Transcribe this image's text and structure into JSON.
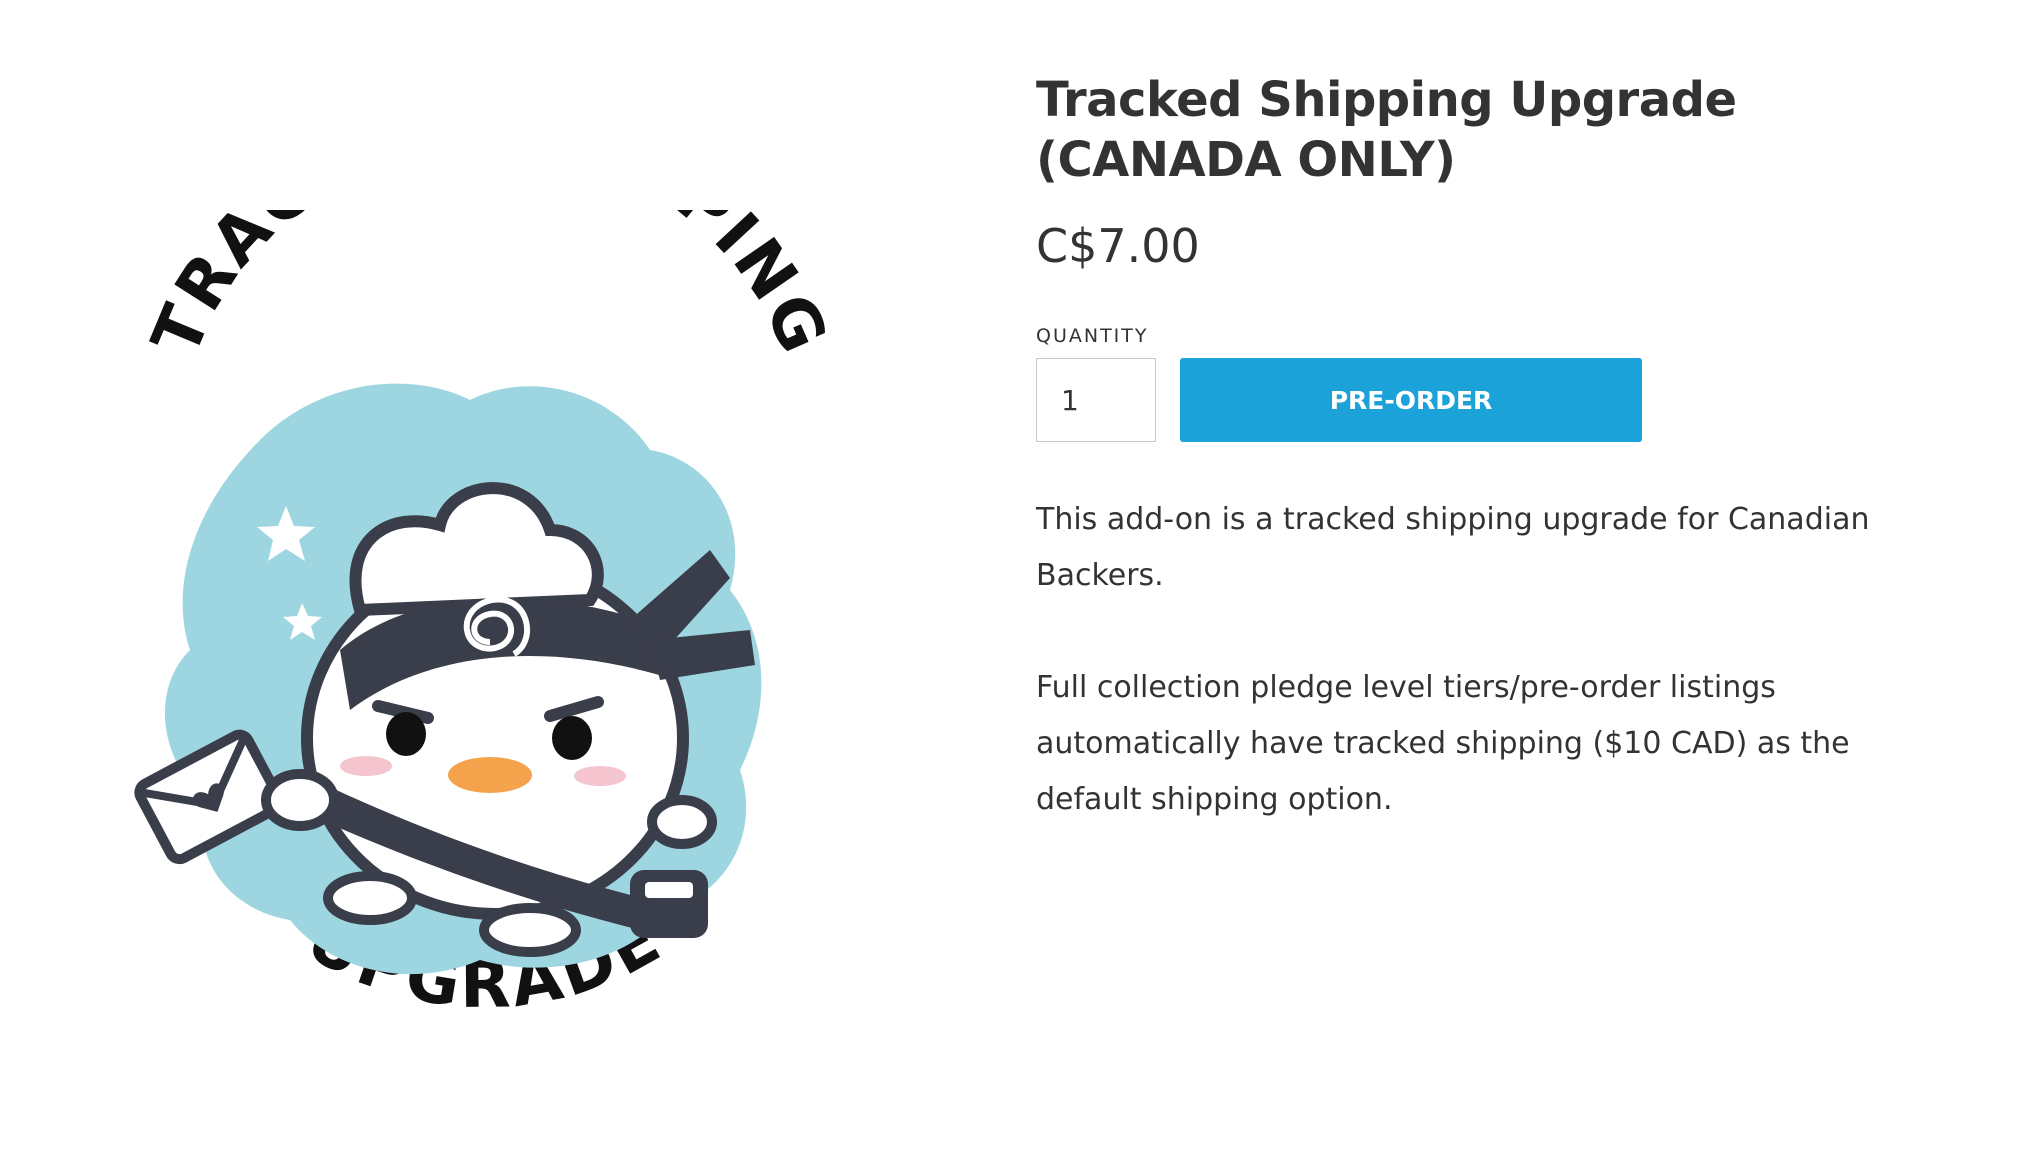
{
  "product": {
    "image_alt": "Tracked Shipping Upgrade illustration",
    "image_text_top": "TRACKED SHIPPING",
    "image_text_bottom": "UPGRADE",
    "title": "Tracked Shipping Upgrade (CANADA ONLY)",
    "price": "C$7.00",
    "quantity_label": "QUANTITY",
    "quantity_value": "1",
    "preorder_label": "PRE-ORDER",
    "description": [
      "This add-on is a tracked shipping upgrade for Canadian Backers.",
      "Full collection pledge level tiers/pre-order listings automatically have tracked shipping ($10 CAD) as the default shipping option."
    ]
  },
  "colors": {
    "accent": "#1ba3d9",
    "splash": "#9dd6e0",
    "dark": "#3a3d4a",
    "text": "#333333"
  }
}
